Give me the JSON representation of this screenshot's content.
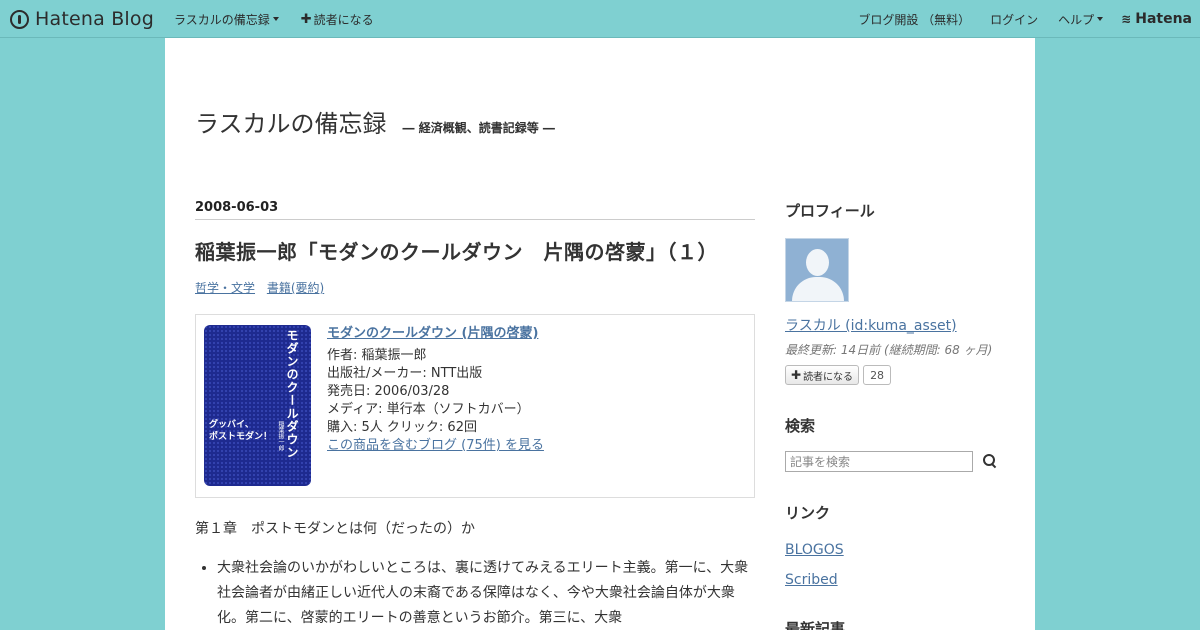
{
  "header": {
    "logo": "Hatena Blog",
    "blog_menu": "ラスカルの備忘録",
    "subscribe": "読者になる",
    "create_blog": "ブログ開設 （無料）",
    "login": "ログイン",
    "help": "ヘルプ",
    "brand": "Hatena"
  },
  "blog": {
    "title": "ラスカルの備忘録",
    "description": "― 経済概観、読書記録等 ―"
  },
  "entry": {
    "date": "2008-06-03",
    "title": "稲葉振一郎「モダンのクールダウン　片隅の啓蒙」（１）",
    "categories": [
      "哲学・文学",
      "書籍(要約)"
    ],
    "amazon": {
      "title": "モダンのクールダウン (片隅の啓蒙)",
      "author": "作者: 稲葉振一郎",
      "publisher": "出版社/メーカー: NTT出版",
      "release": "発売日: 2006/03/28",
      "media": "メディア: 単行本（ソフトカバー）",
      "purchase": "購入: 5人 クリック: 62回",
      "link": "この商品を含むブログ (75件) を見る",
      "cover": {
        "title": "モダンのクールダウン",
        "author": "稲葉振一郎",
        "tagline_1": "グッバイ、",
        "tagline_2": "ポストモダン！"
      }
    },
    "chapter": "第１章　ポストモダンとは何（だったの）か",
    "bullets": [
      "大衆社会論のいかがわしいところは、裏に透けてみえるエリート主義。第一に、大衆社会論者が由緒正しい近代人の末裔である保障はなく、今や大衆社会論自体が大衆化。第二に、啓蒙的エリートの善意というお節介。第三に、大衆"
    ]
  },
  "sidebar": {
    "profile_title": "プロフィール",
    "profile_name": "ラスカル (id:kuma_asset)",
    "profile_meta": "最終更新: 14日前 (継続期間: 68 ヶ月)",
    "subscribe_label": "読者になる",
    "subscriber_count": "28",
    "search_title": "検索",
    "search_placeholder": "記事を検索",
    "links_title": "リンク",
    "links": [
      "BLOGOS",
      "Scribed"
    ],
    "recent_title": "最新記事"
  }
}
